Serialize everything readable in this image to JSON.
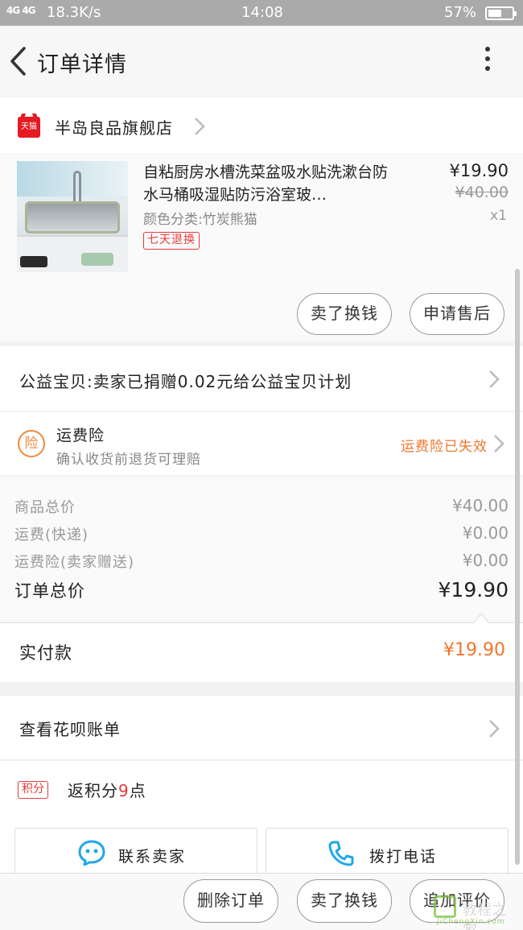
{
  "status_bar": {
    "signal": "4G 4G",
    "speed": "18.3K/s",
    "time": "14:08",
    "battery_text": "57%",
    "battery_level": 0.57
  },
  "header": {
    "title": "订单详情"
  },
  "shop": {
    "badge": "天猫",
    "name": "半岛良品旗舰店"
  },
  "product": {
    "title": "自粘厨房水槽洗菜盆吸水贴洗漱台防水马桶吸湿贴防污浴室玻…",
    "spec": "颜色分类:竹炭熊猫",
    "price": "¥19.90",
    "original_price": "¥40.00",
    "quantity": "x1",
    "badge": "七天退换"
  },
  "product_actions": {
    "exchange": "卖了换钱",
    "after_sale": "申请售后"
  },
  "charity": {
    "text": "公益宝贝:卖家已捐赠0.02元给公益宝贝计划"
  },
  "freight_insurance": {
    "icon_text": "险",
    "title": "运费险",
    "subtitle": "确认收货前退货可理赔",
    "status": "运费险已失效"
  },
  "summary": {
    "rows": [
      {
        "label": "商品总价",
        "value": "¥40.00"
      },
      {
        "label": "运费(快递)",
        "value": "¥0.00"
      },
      {
        "label": "运费险(卖家赠送)",
        "value": "¥0.00"
      }
    ],
    "total_label": "订单总价",
    "total_value": "¥19.90"
  },
  "payment": {
    "label": "实付款",
    "value": "¥19.90"
  },
  "huabei": {
    "text": "查看花呗账单"
  },
  "points": {
    "badge": "积分",
    "prefix": "返积分",
    "count": "9",
    "suffix": "点"
  },
  "contact": {
    "seller": "联系卖家",
    "call": "拨打电话"
  },
  "bottom_actions": {
    "delete": "删除订单",
    "exchange": "卖了换钱",
    "review": "追加评价"
  },
  "watermark": {
    "text": "教程之家",
    "url": "JiChengXin.com"
  },
  "colors": {
    "accent": "#f0762e",
    "tmall_red": "#e51a22",
    "badge_red": "#e53a3a",
    "contact_blue": "#1fa8e8"
  }
}
